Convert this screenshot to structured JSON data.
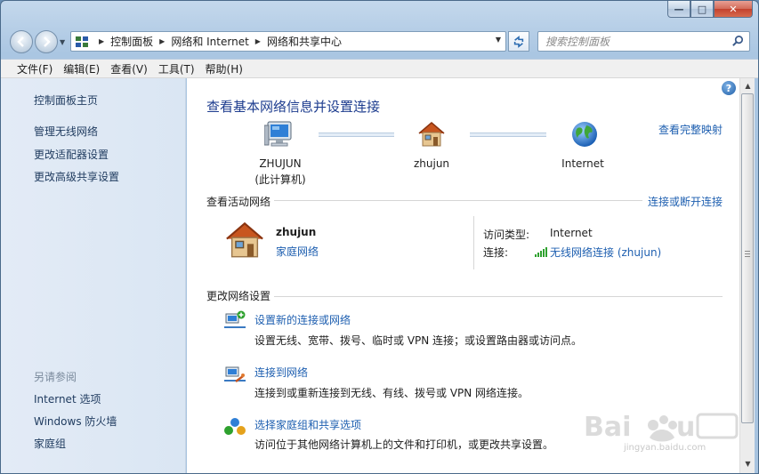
{
  "window": {
    "caption_buttons": {
      "minimize": "—",
      "maximize": "□",
      "close": "✕"
    }
  },
  "nav": {
    "breadcrumb": [
      "控制面板",
      "网络和 Internet",
      "网络和共享中心"
    ],
    "search_placeholder": "搜索控制面板"
  },
  "menu": [
    "文件(F)",
    "编辑(E)",
    "查看(V)",
    "工具(T)",
    "帮助(H)"
  ],
  "sidebar": {
    "home": "控制面板主页",
    "links": [
      "管理无线网络",
      "更改适配器设置",
      "更改高级共享设置"
    ],
    "see_also_heading": "另请参阅",
    "see_also": [
      "Internet 选项",
      "Windows 防火墙",
      "家庭组"
    ]
  },
  "main": {
    "title": "查看基本网络信息并设置连接",
    "full_map_link": "查看完整映射",
    "nodes": {
      "computer_name": "ZHUJUN",
      "computer_sub": "(此计算机)",
      "network": "zhujun",
      "internet": "Internet"
    },
    "active_section": {
      "title": "查看活动网络",
      "action_link": "连接或断开连接",
      "network_name": "zhujun",
      "network_type": "家庭网络",
      "access_type_label": "访问类型:",
      "access_type_value": "Internet",
      "connection_label": "连接:",
      "connection_value": "无线网络连接 (zhujun)"
    },
    "change_section": {
      "title": "更改网络设置",
      "tasks": [
        {
          "title": "设置新的连接或网络",
          "desc": "设置无线、宽带、拨号、临时或 VPN 连接；或设置路由器或访问点。"
        },
        {
          "title": "连接到网络",
          "desc": "连接到或重新连接到无线、有线、拨号或 VPN 网络连接。"
        },
        {
          "title": "选择家庭组和共享选项",
          "desc": "访问位于其他网络计算机上的文件和打印机，或更改共享设置。"
        }
      ]
    }
  },
  "watermark": {
    "text": "jingyan.baidu.com"
  },
  "colors": {
    "link": "#1e5fb0",
    "title": "#1e3d8f",
    "sidebar_bg": "#dae6f3"
  }
}
